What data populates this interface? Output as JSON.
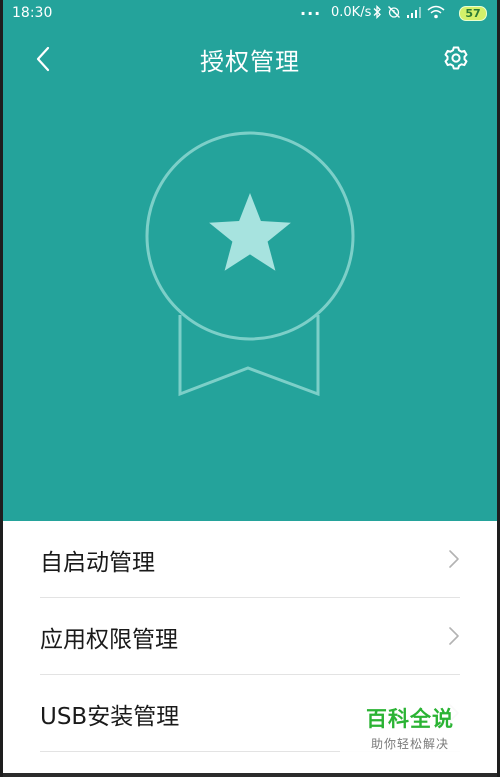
{
  "status_bar": {
    "time": "18:30",
    "dots": "...",
    "speed": "0.0K/s",
    "battery": "57",
    "icons": [
      "bluetooth-icon",
      "alarm-off-icon",
      "signal-icon",
      "wifi-icon",
      "battery-icon"
    ]
  },
  "header": {
    "title": "授权管理",
    "back_icon": "chevron-left-icon",
    "settings_icon": "gear-icon"
  },
  "hero": {
    "background_color": "#24a39b",
    "badge_icon": "star-medal-icon"
  },
  "menu": {
    "items": [
      {
        "label": "自启动管理",
        "icon": "chevron-right-icon"
      },
      {
        "label": "应用权限管理",
        "icon": "chevron-right-icon"
      },
      {
        "label": "USB安装管理",
        "icon": "chevron-right-icon"
      }
    ]
  },
  "watermark": {
    "title": "百科全说",
    "subtitle": "助你轻松解决"
  }
}
